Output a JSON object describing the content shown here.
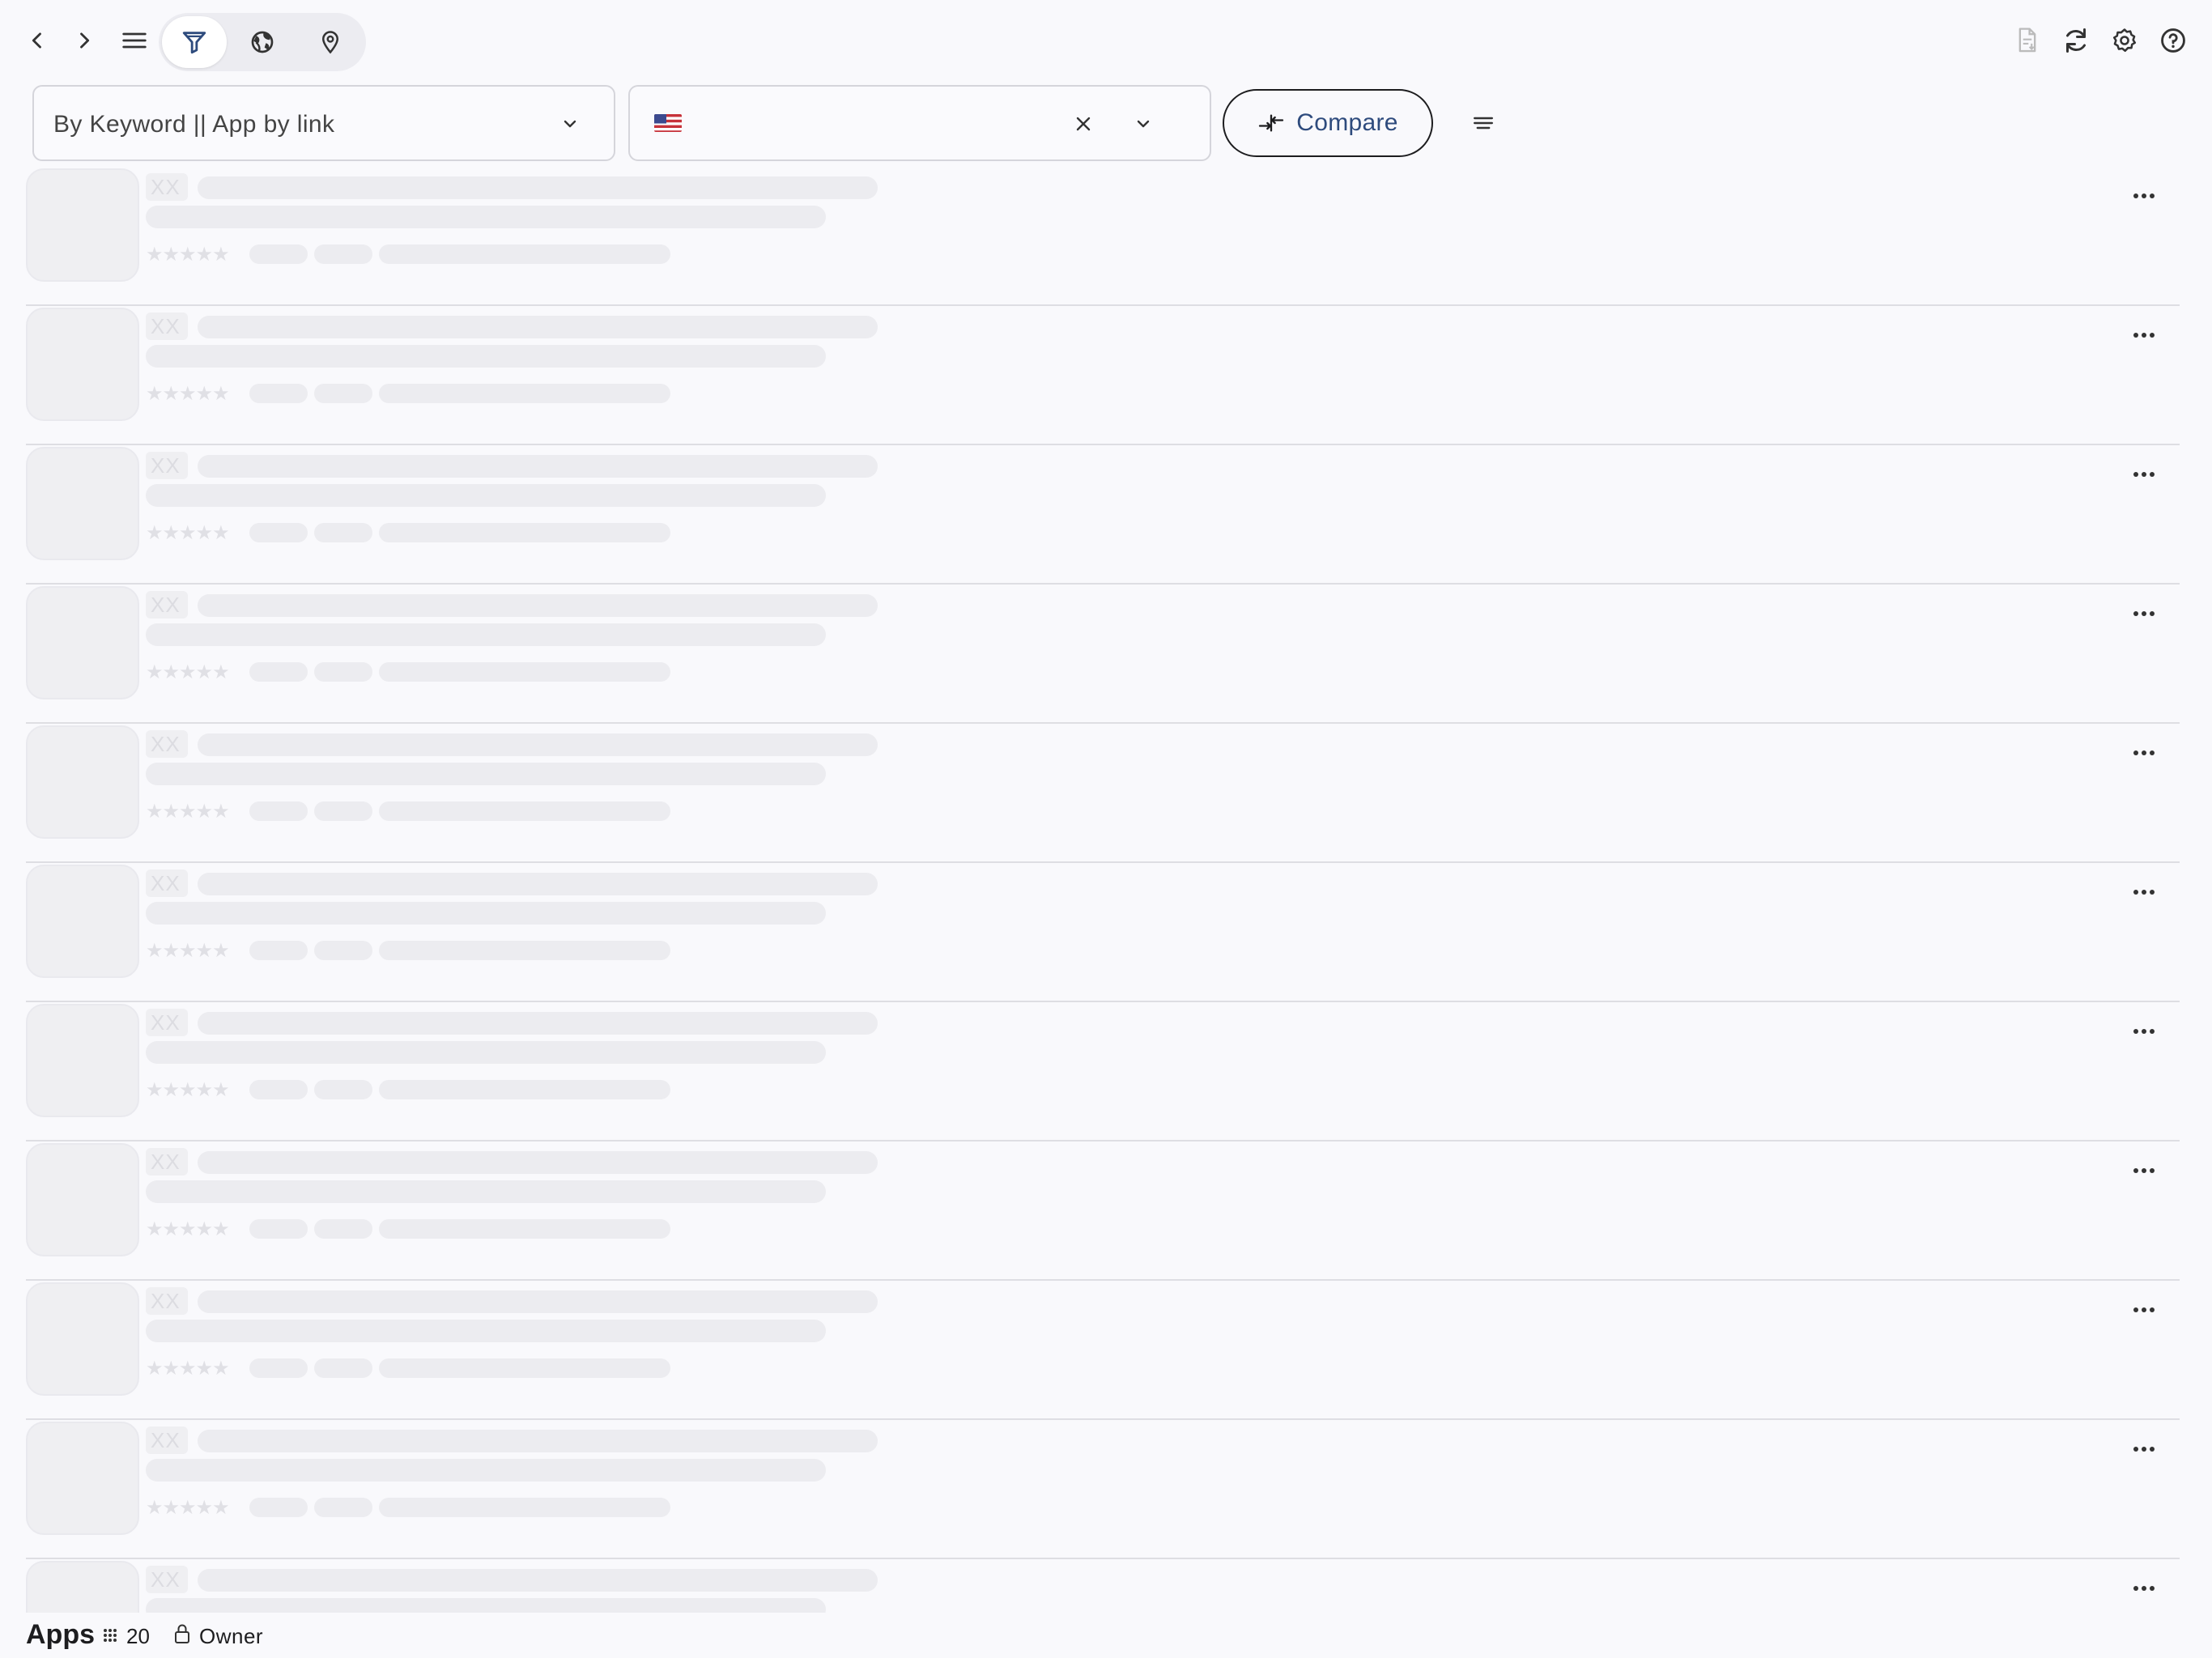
{
  "toolbar": {
    "nav": [
      {
        "icon": "chevron-left-icon"
      },
      {
        "icon": "chevron-right-icon"
      },
      {
        "icon": "menu-icon"
      }
    ],
    "view_modes": [
      {
        "icon": "filter-icon",
        "active": true
      },
      {
        "icon": "globe-icon",
        "active": false
      },
      {
        "icon": "location-pin-icon",
        "active": false
      }
    ],
    "right_actions": [
      {
        "icon": "document-export-icon"
      },
      {
        "icon": "refresh-icon"
      },
      {
        "icon": "gear-icon"
      },
      {
        "icon": "help-icon"
      }
    ]
  },
  "filters": {
    "search_mode_label": "By Keyword || App by link",
    "country": {
      "flag": "us-flag-icon",
      "value": ""
    },
    "compare_label": "Compare",
    "sort_icon": "sort-lines-icon"
  },
  "list": {
    "loading": true,
    "placeholder_rank": "XX",
    "placeholder_rating": "★★★★★",
    "rows_visible": 11
  },
  "footer": {
    "title": "Apps",
    "count": "20",
    "owner_label": "Owner"
  },
  "colors": {
    "background": "#f9f9fc",
    "skeleton": "#ececf0",
    "compare_text": "#2e4b7d",
    "divider": "#dedee3"
  }
}
